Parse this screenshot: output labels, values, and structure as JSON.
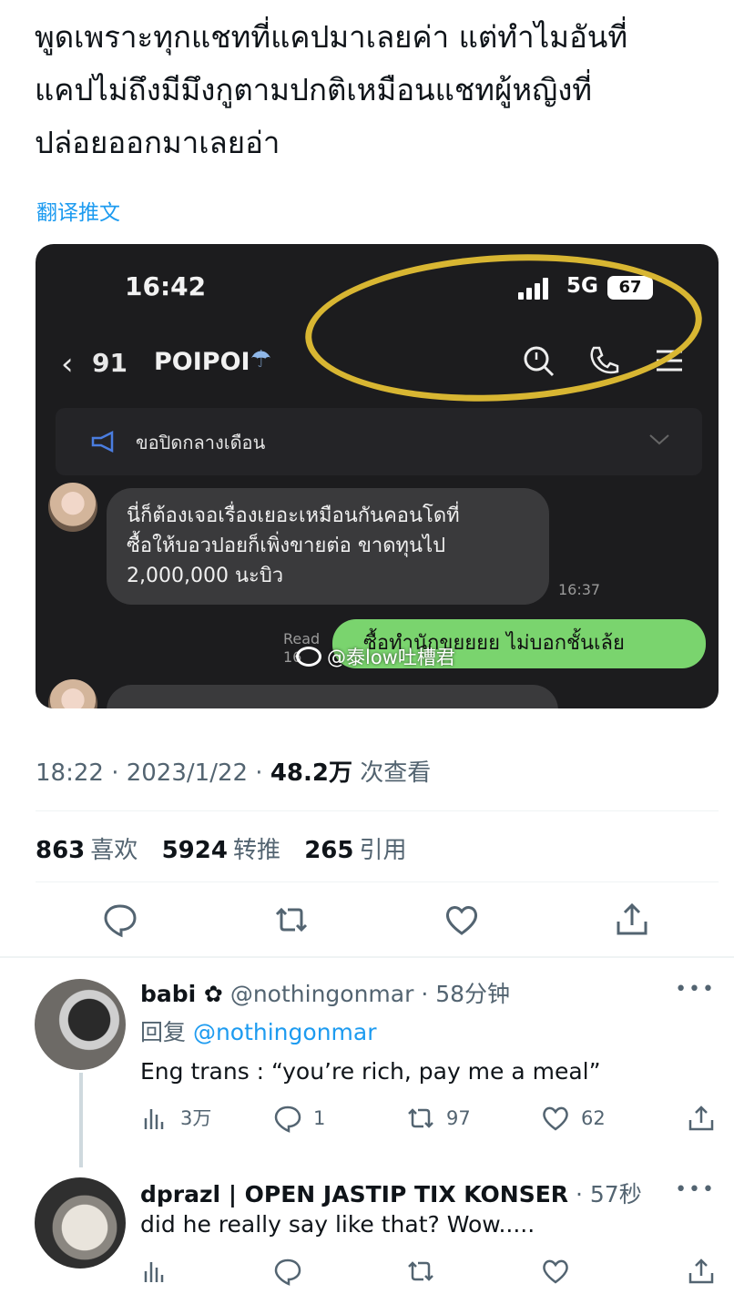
{
  "tweet": {
    "text_line1": "พูดเพราะทุกแชทที่แคปมาเลยค่า แต่ทำไมอันที่",
    "text_line2": "แคปไม่ถึงมีมึงกูตามปกติเหมือนแชทผู้หญิงที่",
    "text_line3": "ปล่อยออกมาเลยอ่า",
    "translate_label": "翻译推文",
    "timestamp": "18:22 · 2023/1/22 · ",
    "views_count": "48.2万",
    "views_label": " 次查看",
    "likes_count": "863",
    "likes_label": "喜欢",
    "retweets_count": "5924",
    "retweets_label": "转推",
    "quotes_count": "265",
    "quotes_label": "引用"
  },
  "screenshot": {
    "time": "16:42",
    "network": "5G",
    "battery": "67",
    "back_count": "91",
    "chat_name": "POIPOI",
    "announcement": "ขอปิดกลางเดือน",
    "incoming_line1": "นี่ก็ต้องเจอเรื่องเยอะเหมือนกันคอนโดที่",
    "incoming_line2": "ซื้อให้บอวปอยก็เพิ่งขายต่อ ขาดทุนไป",
    "incoming_line3": "2,000,000 นะบิว",
    "incoming_time": "16:37",
    "read_label": "Read",
    "read_time": "16",
    "outgoing": "ซื้อทำนักขยยยย ไม่บอกชั้นเล้ย",
    "watermark": "@泰low吐槽君"
  },
  "replies": [
    {
      "name": "babi ✿",
      "handle": " @nothingonmar · 58分钟",
      "reply_prefix": "回复 ",
      "reply_to": "@nothingonmar",
      "text": "Eng trans : “you’re rich, pay me a meal”",
      "views": "3万",
      "replies": "1",
      "retweets": "97",
      "likes": "62",
      "more": "•••"
    },
    {
      "name": "dprazl | OPEN JASTIP TIX KONSER",
      "handle": " · 57秒",
      "text": "did he really say like that? Wow.....",
      "more": "•••"
    }
  ],
  "colors": {
    "link": "#1d9bf0",
    "muted": "#536471",
    "highlight_ring": "#d8b632",
    "chat_out_bubble": "#7ad46e"
  }
}
